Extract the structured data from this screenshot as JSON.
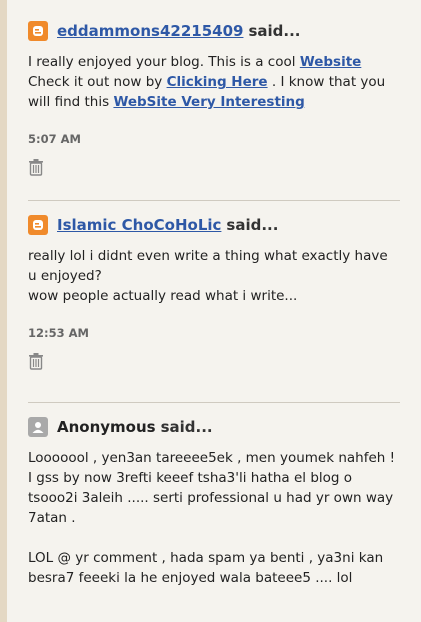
{
  "comments": [
    {
      "author": "eddammons42215409",
      "said": "said...",
      "body_pre": "I really enjoyed your blog. This is a cool",
      "link1": "Website",
      "body_mid1": "Check it out now by",
      "link2": "Clicking Here",
      "body_mid2": ". I know that you will find this",
      "link3": "WebSite Very Interesting",
      "timestamp": "5:07 AM",
      "icon": "blogger-icon"
    },
    {
      "author": "Islamic ChoCoHoLic",
      "said": "said...",
      "line1": "really lol i didnt even write a thing what exactly have u enjoyed?",
      "line2": "wow people actually read what i write...",
      "timestamp": "12:53 AM",
      "icon": "blogger-icon"
    },
    {
      "author": "Anonymous",
      "said": "said...",
      "para1": "Looooool , yen3an tareeee5ek , men youmek nahfeh ! I gss by now 3refti keeef tsha3'li hatha el blog o tsooo2i 3aleih ..... serti professional u had yr own way 7atan .",
      "para2": "LOL @ yr comment , hada spam ya benti , ya3ni kan besra7 feeeki la he enjoyed wala bateee5 .... lol",
      "icon": "anonymous-user-icon"
    }
  ],
  "colors": {
    "link": "#2e58a6",
    "blogger_orange": "#f08a2b",
    "background": "#f5f3ee"
  }
}
